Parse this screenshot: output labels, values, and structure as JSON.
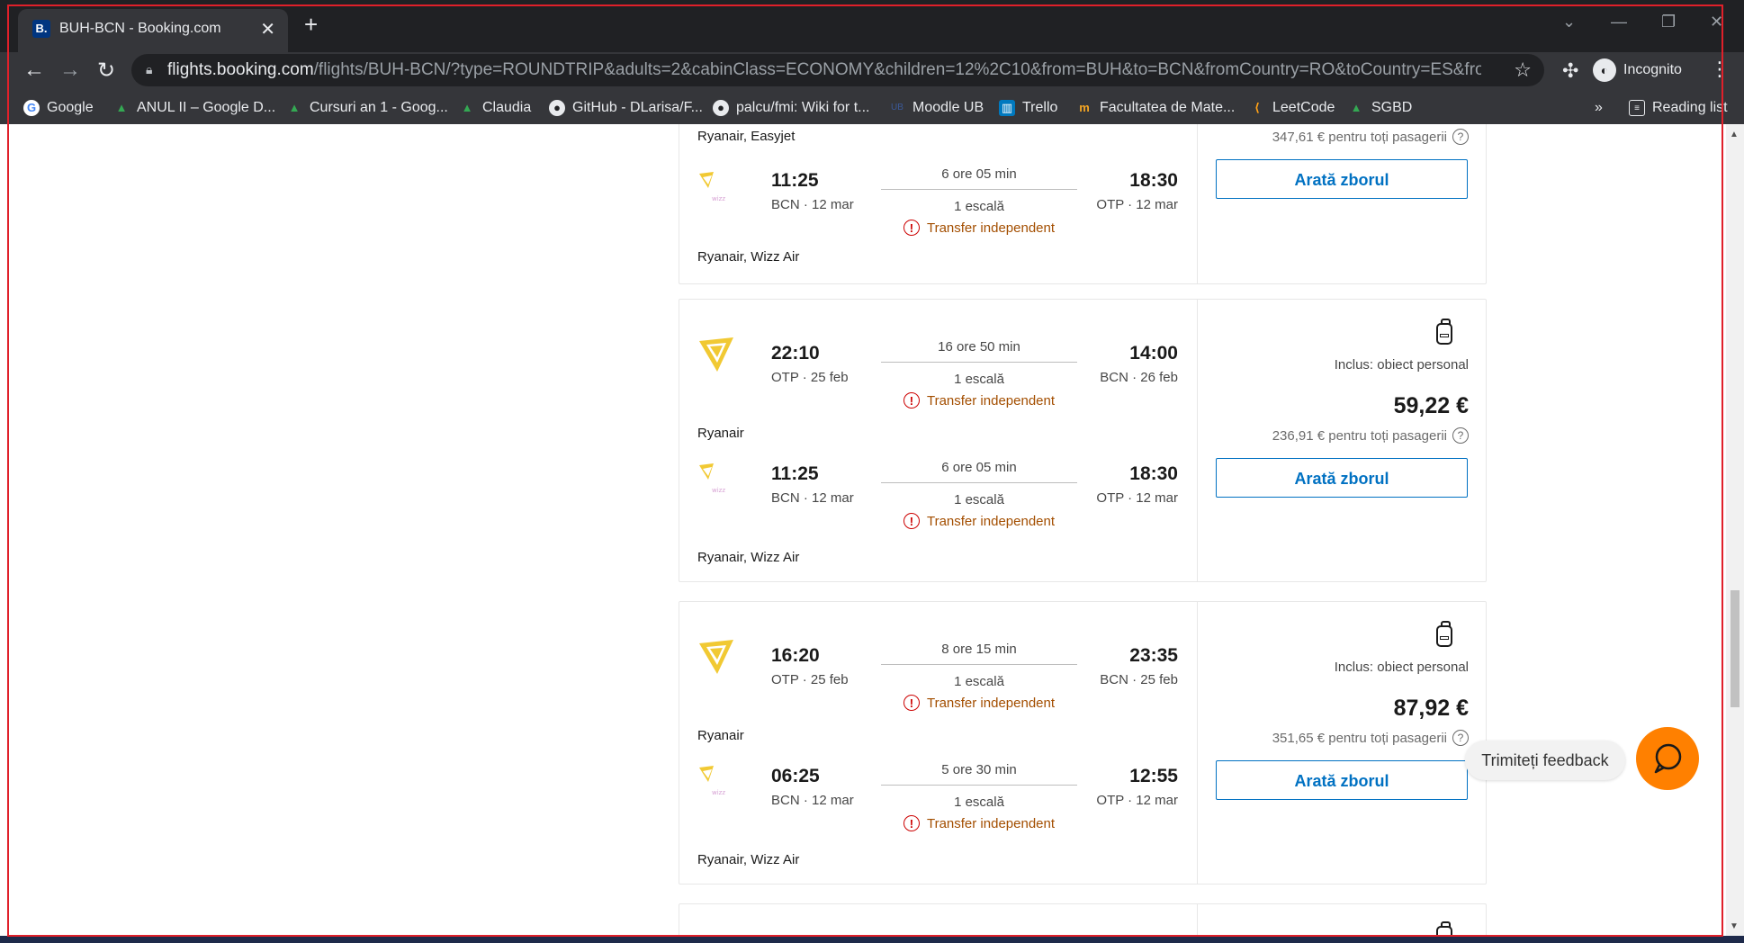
{
  "browser": {
    "tab_title": "BUH-BCN - Booking.com",
    "tab_favicon": "B.",
    "url_domain": "flights.booking.com",
    "url_path": "/flights/BUH-BCN/?type=ROUNDTRIP&adults=2&cabinClass=ECONOMY&children=12%2C10&from=BUH&to=BCN&fromCountry=RO&toCountry=ES&fromLocationNa...",
    "incognito_label": "Incognito",
    "bookmarks": [
      {
        "label": "Google",
        "icon": "google-icon"
      },
      {
        "label": "ANUL II – Google D...",
        "icon": "drive-icon"
      },
      {
        "label": "Cursuri an 1 - Goog...",
        "icon": "drive-icon"
      },
      {
        "label": "Claudia",
        "icon": "drive-icon"
      },
      {
        "label": "GitHub - DLarisa/F...",
        "icon": "github-icon"
      },
      {
        "label": "palcu/fmi: Wiki for t...",
        "icon": "github-icon"
      },
      {
        "label": "Moodle UB",
        "icon": "moodle-icon"
      },
      {
        "label": "Trello",
        "icon": "trello-icon"
      },
      {
        "label": "Facultatea de Mate...",
        "icon": "fmi-icon"
      },
      {
        "label": "LeetCode",
        "icon": "leetcode-icon"
      },
      {
        "label": "SGBD",
        "icon": "drive-icon"
      }
    ],
    "more_bookmarks": "»",
    "reading_list": "Reading list"
  },
  "results": [
    {
      "legs": [
        {
          "dep_time": "11:25",
          "dep_place": "BCN · 12 mar",
          "duration": "6 ore 05 min",
          "stops": "1 escală",
          "transfer": "Transfer independent",
          "arr_time": "18:30",
          "arr_place": "OTP · 12 mar",
          "airline": "Ryanair, Wizz Air"
        }
      ],
      "top_airline": "Ryanair, Easyjet",
      "total": "347,61 € pentru toți pasagerii",
      "button": "Arată zborul"
    },
    {
      "legs": [
        {
          "dep_time": "22:10",
          "dep_place": "OTP · 25 feb",
          "duration": "16 ore 50 min",
          "stops": "1 escală",
          "transfer": "Transfer independent",
          "arr_time": "14:00",
          "arr_place": "BCN · 26 feb",
          "airline": "Ryanair"
        },
        {
          "dep_time": "11:25",
          "dep_place": "BCN · 12 mar",
          "duration": "6 ore 05 min",
          "stops": "1 escală",
          "transfer": "Transfer independent",
          "arr_time": "18:30",
          "arr_place": "OTP · 12 mar",
          "airline": "Ryanair, Wizz Air"
        }
      ],
      "included": "Inclus: obiect personal",
      "price": "59,22 €",
      "total": "236,91 € pentru toți pasagerii",
      "button": "Arată zborul"
    },
    {
      "legs": [
        {
          "dep_time": "16:20",
          "dep_place": "OTP · 25 feb",
          "duration": "8 ore 15 min",
          "stops": "1 escală",
          "transfer": "Transfer independent",
          "arr_time": "23:35",
          "arr_place": "BCN · 25 feb",
          "airline": "Ryanair"
        },
        {
          "dep_time": "06:25",
          "dep_place": "BCN · 12 mar",
          "duration": "5 ore 30 min",
          "stops": "1 escală",
          "transfer": "Transfer independent",
          "arr_time": "12:55",
          "arr_place": "OTP · 12 mar",
          "airline": "Ryanair, Wizz Air"
        }
      ],
      "included": "Inclus: obiect personal",
      "price": "87,92 €",
      "total": "351,65 € pentru toți pasagerii",
      "button": "Arată zborul"
    }
  ],
  "feedback_label": "Trimiteți feedback",
  "colors": {
    "accent": "#0071c2",
    "transfer": "#a34e00",
    "warning": "#cc0000",
    "chat": "#ff8000"
  }
}
